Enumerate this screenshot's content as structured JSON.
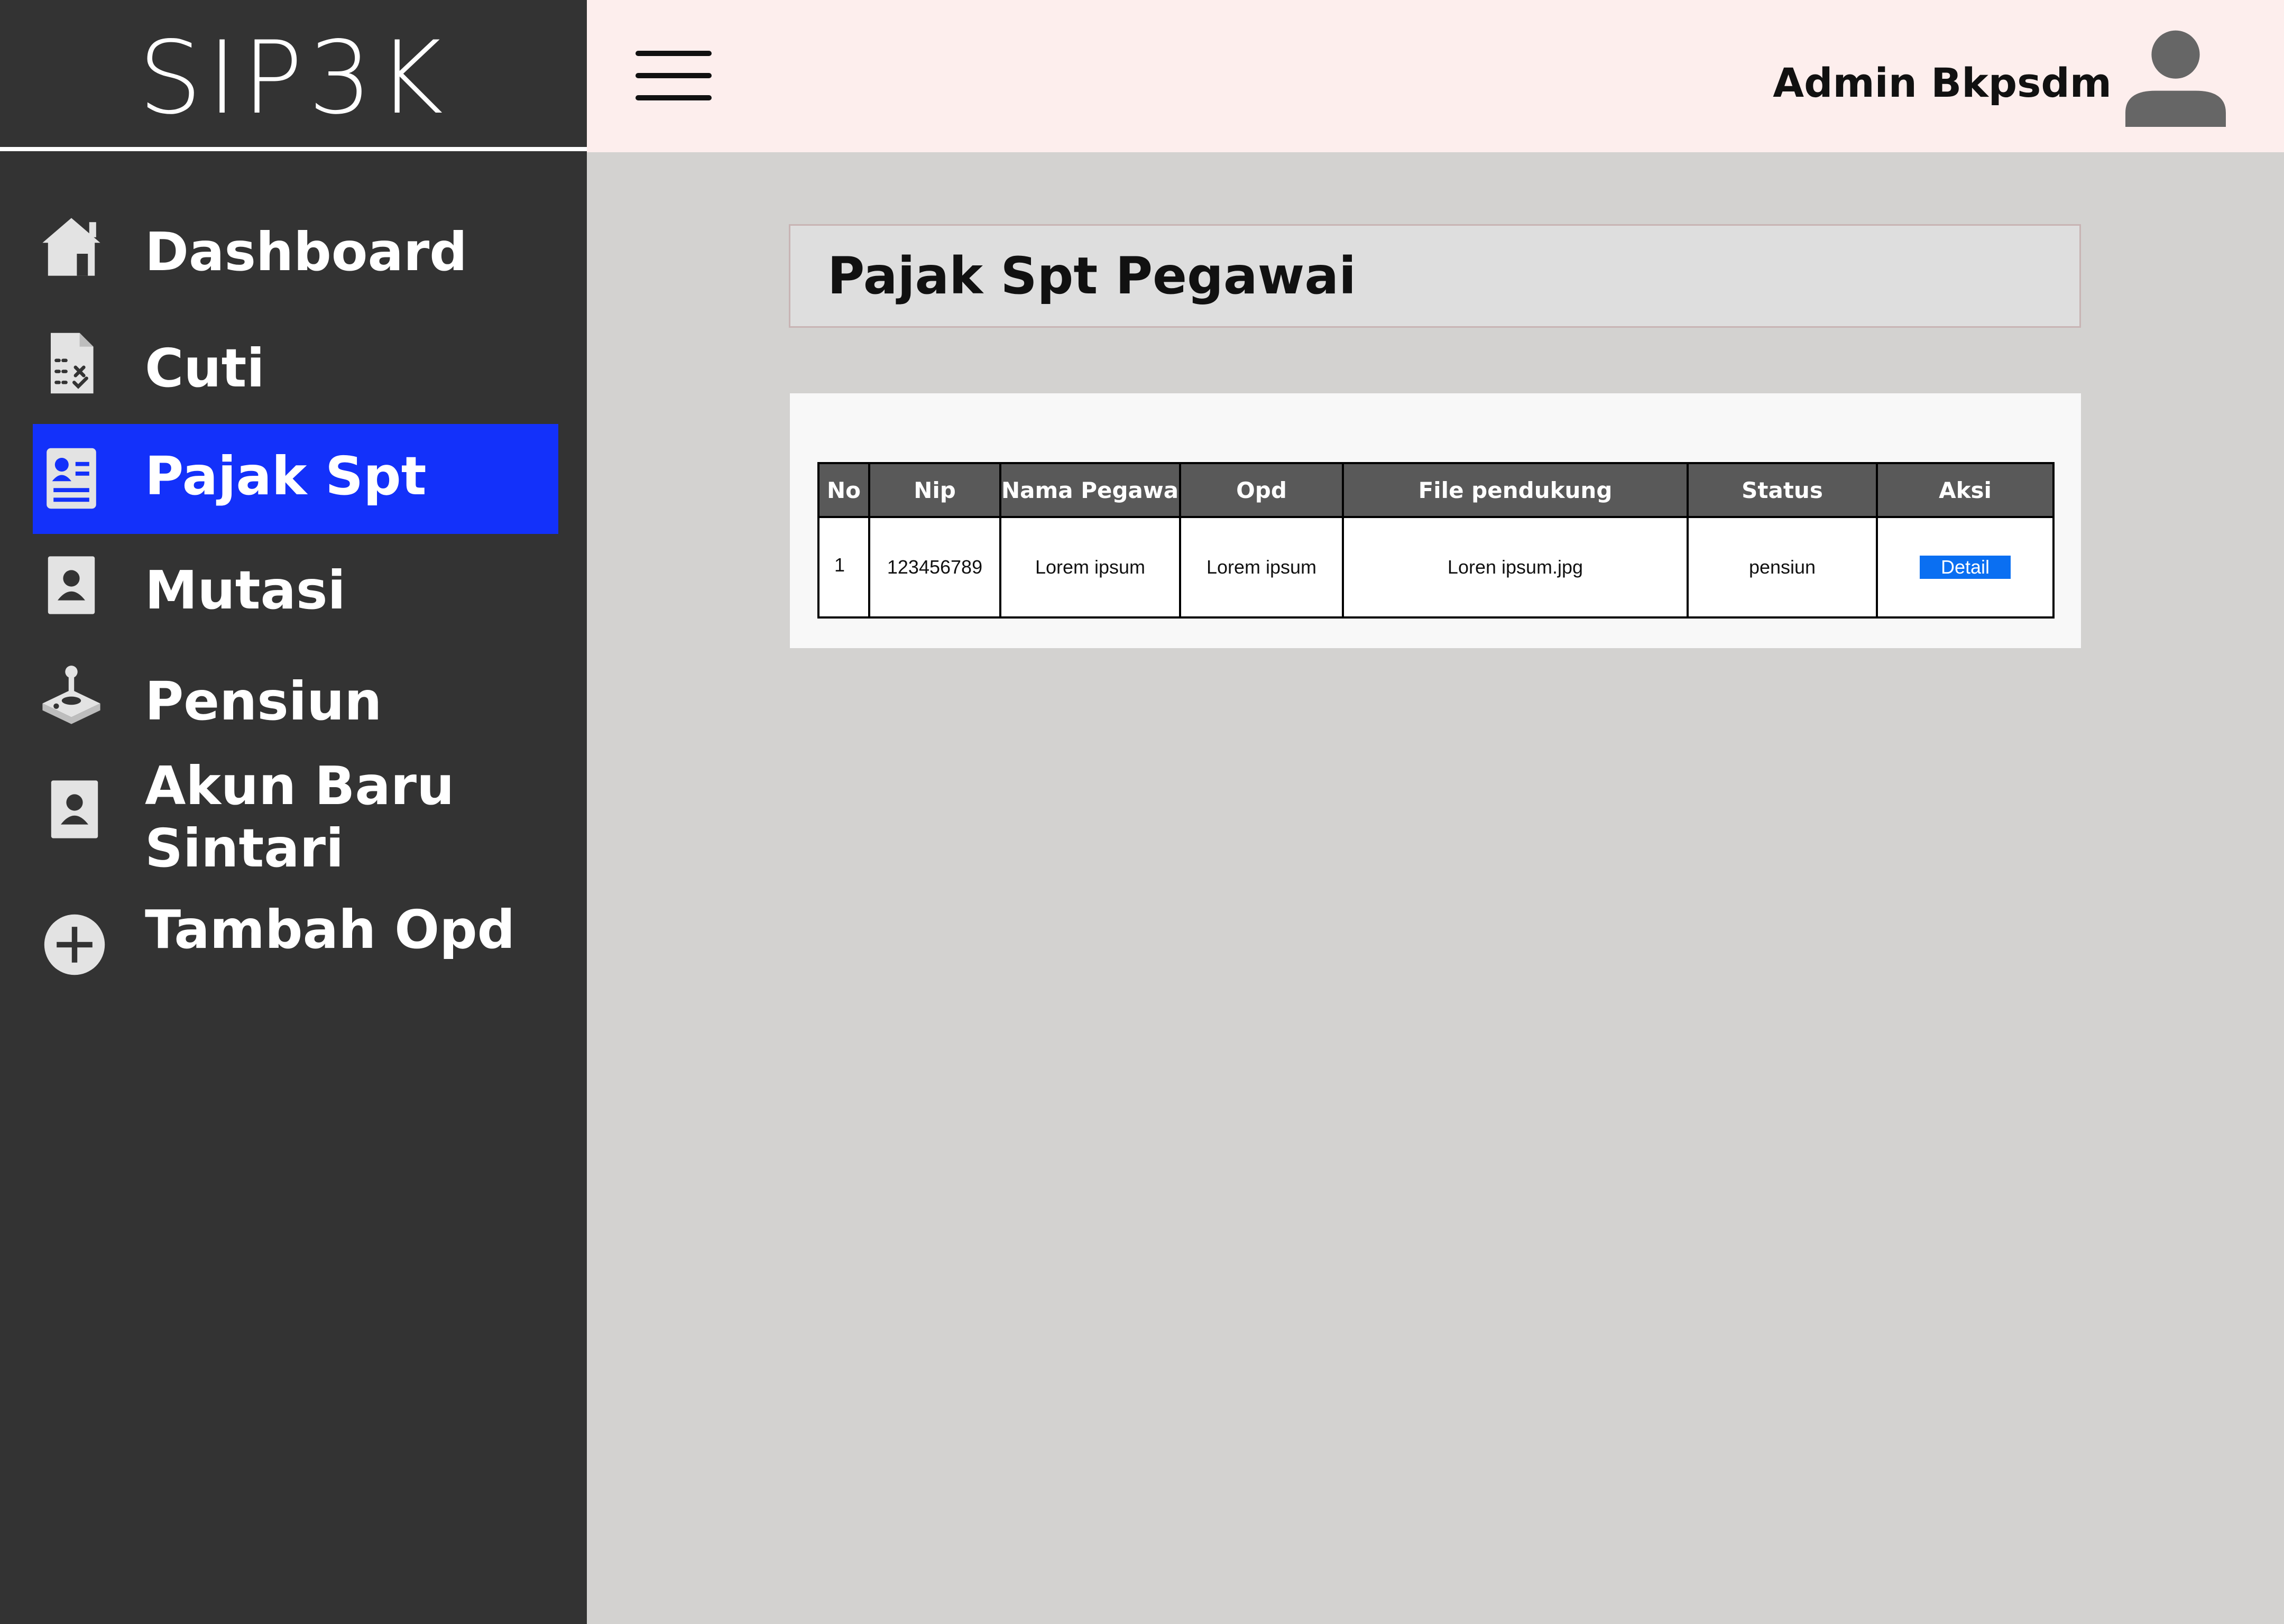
{
  "app": {
    "title": "SIP3K"
  },
  "sidebar": {
    "items": [
      {
        "label": "Dashboard",
        "icon": "home-icon"
      },
      {
        "label": "Cuti",
        "icon": "checklist-document-icon"
      },
      {
        "label": "Pajak Spt",
        "icon": "profile-card-icon",
        "active": true
      },
      {
        "label": "Mutasi",
        "icon": "user-card-icon"
      },
      {
        "label": "Pensiun",
        "icon": "joystick-icon"
      },
      {
        "label": "Akun Baru",
        "label_line2": "Sintari",
        "icon": "user-card-icon"
      },
      {
        "label": "Tambah Opd",
        "icon": "plus-circle-icon"
      }
    ]
  },
  "header": {
    "user_name": "Admin Bkpsdm",
    "menu_icon": "hamburger-icon",
    "avatar_icon": "user-avatar-icon"
  },
  "main": {
    "title": "Pajak Spt Pegawai",
    "table": {
      "headers": [
        "No",
        "Nip",
        "Nama Pegawai",
        "Opd",
        "File pendukung",
        "Status",
        "Aksi"
      ],
      "rows": [
        {
          "no": "1",
          "nip": "123456789",
          "nama": "Lorem ipsum",
          "opd": "Lorem ipsum",
          "file": "Loren ipsum.jpg",
          "status": "pensiun",
          "aksi": "Detail"
        }
      ]
    }
  },
  "colors": {
    "sidebar_bg": "#333333",
    "active_item": "#1331fa",
    "topbar_bg": "#fdeeed",
    "content_bg": "#d3d2d0",
    "table_header_bg": "#595959",
    "detail_button": "#0a6ff2"
  }
}
